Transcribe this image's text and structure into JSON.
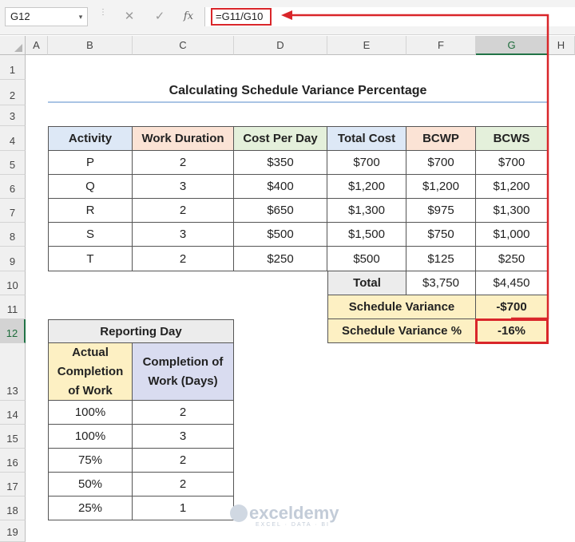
{
  "formula_bar": {
    "name_box": "G12",
    "name_box_arrow": "▾",
    "cancel": "✕",
    "enter": "✓",
    "fx": "fx",
    "formula": "=G11/G10"
  },
  "columns": [
    "A",
    "B",
    "C",
    "D",
    "E",
    "F",
    "G",
    "H"
  ],
  "rows": [
    "1",
    "2",
    "3",
    "4",
    "5",
    "6",
    "7",
    "8",
    "9",
    "10",
    "11",
    "12",
    "13",
    "14",
    "15",
    "16",
    "17",
    "18",
    "19"
  ],
  "selected_cell": "G12",
  "title": "Calculating Schedule Variance Percentage",
  "main_table": {
    "headers": [
      "Activity",
      "Work Duration",
      "Cost Per Day",
      "Total Cost",
      "BCWP",
      "BCWS"
    ],
    "rows": [
      [
        "P",
        "2",
        "$350",
        "$700",
        "$700",
        "$700"
      ],
      [
        "Q",
        "3",
        "$400",
        "$1,200",
        "$1,200",
        "$1,200"
      ],
      [
        "R",
        "2",
        "$650",
        "$1,300",
        "$975",
        "$1,300"
      ],
      [
        "S",
        "3",
        "$500",
        "$1,500",
        "$750",
        "$1,000"
      ],
      [
        "T",
        "2",
        "$250",
        "$500",
        "$125",
        "$250"
      ]
    ],
    "total_label": "Total",
    "total_bcwp": "$3,750",
    "total_bcws": "$4,450",
    "sv_label": "Schedule Variance",
    "sv_value": "-$700",
    "svp_label": "Schedule Variance %",
    "svp_value": "-16%"
  },
  "reporting_table": {
    "title": "Reporting Day",
    "headers": [
      "Actual Completion of Work",
      "Completion of Work (Days)"
    ],
    "rows": [
      [
        "100%",
        "2"
      ],
      [
        "100%",
        "3"
      ],
      [
        "75%",
        "2"
      ],
      [
        "50%",
        "2"
      ],
      [
        "25%",
        "1"
      ]
    ]
  },
  "watermark": {
    "text": "exceldemy",
    "sub": "EXCEL · DATA · BI"
  },
  "colors": {
    "highlight": "#d9262a",
    "activity_header": "#dde8f6",
    "work_duration_header": "#fbe3d5",
    "cost_per_day_header": "#e4f0db",
    "bcwp_header": "#fbe3d5",
    "bcws_header": "#e4f0db",
    "variance_fill": "#fdf0c3"
  }
}
